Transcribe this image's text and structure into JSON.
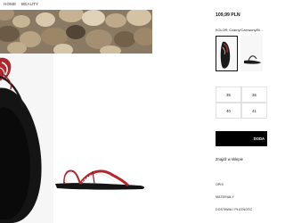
{
  "nav": {
    "home": "HOME",
    "beauty": "BEAUTY"
  },
  "product": {
    "price": "109,99 PLN",
    "color_line": "KOLOR: Czarny/Czerwony/Bi...",
    "sizes": [
      "35",
      "36",
      "40",
      "41"
    ],
    "add_button": "DODA",
    "store_link": "Znajdź w sklepie",
    "accordion": [
      "OPIS",
      "MATERIAŁY",
      "DOSTAWA I PŁATNOŚĆ"
    ]
  },
  "colors": {
    "accent_black": "#000000",
    "strap_red": "#b3262e",
    "sole_black": "#141414"
  },
  "icons": [
    "sandal-photo",
    "stone-photo"
  ]
}
